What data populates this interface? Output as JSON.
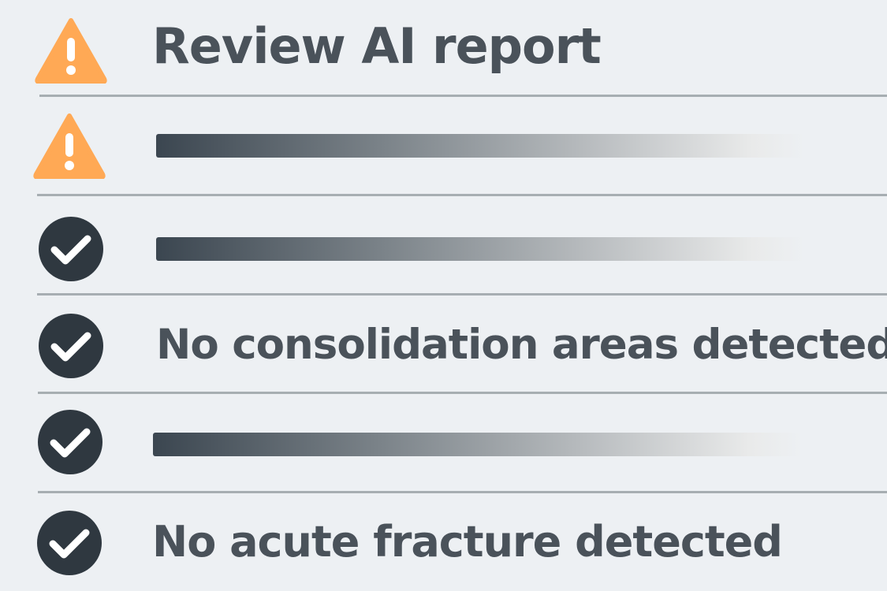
{
  "colors": {
    "background": "#edf0f3",
    "warning": "#ffa955",
    "check_fill": "#2f3840",
    "text": "#4a525a",
    "divider": "#a7aeb2"
  },
  "rows": [
    {
      "status": "warning",
      "icon": "warning-triangle-icon",
      "label": "Review AI report",
      "redacted": false
    },
    {
      "status": "warning",
      "icon": "warning-triangle-icon",
      "label": "",
      "redacted": true
    },
    {
      "status": "ok",
      "icon": "check-circle-icon",
      "label": "",
      "redacted": true
    },
    {
      "status": "ok",
      "icon": "check-circle-icon",
      "label": "No consolidation areas detected",
      "redacted": false
    },
    {
      "status": "ok",
      "icon": "check-circle-icon",
      "label": "",
      "redacted": true
    },
    {
      "status": "ok",
      "icon": "check-circle-icon",
      "label": "No acute fracture detected",
      "redacted": false
    }
  ]
}
